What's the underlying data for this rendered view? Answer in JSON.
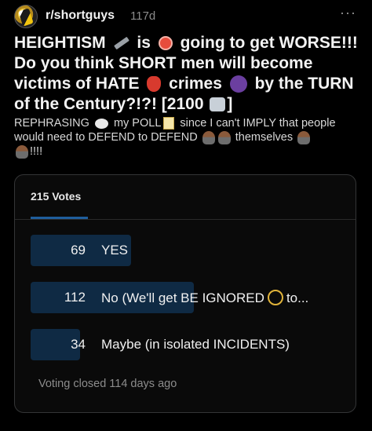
{
  "header": {
    "community": "r/shortguys",
    "age": "117d",
    "more_label": "···"
  },
  "post": {
    "title_parts": [
      "HEIGHTISM",
      "is",
      "going to get WORSE!!! Do you think SHORT men will become victims of HATE",
      "crimes",
      "by the TURN of the Century?!?! [2100",
      "]"
    ],
    "body_parts": [
      "REPHRASING",
      "my POLL",
      "since I can't IMPLY that people would need to DEFEND to DEFEND",
      "themselves",
      "!!!!"
    ]
  },
  "poll": {
    "votes_label": "215 Votes",
    "options": [
      {
        "count": "69",
        "label": "YES",
        "votes": 69
      },
      {
        "count": "112",
        "label_before": "No (We'll get BE IGNORED",
        "label_after": "to...",
        "votes": 112
      },
      {
        "count": "34",
        "label": "Maybe (in isolated INCIDENTS)",
        "votes": 34
      }
    ],
    "closed_text": "Voting closed 114 days ago"
  },
  "icons": [
    "avatar",
    "ruler-icon",
    "alarm-clock-icon",
    "goblin-mask-icon",
    "supervillain-icon",
    "robot-icon",
    "speech-bubble-icon",
    "memo-icon",
    "person-gesturing-no-icon",
    "neutral-face-icon",
    "more-options-icon"
  ],
  "colors": {
    "background": "#000000",
    "bar": "#0f2a44",
    "tab_underline": "#1f5e9c"
  }
}
